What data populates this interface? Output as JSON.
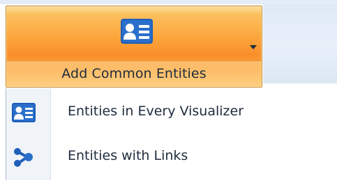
{
  "ribbon": {
    "add_common_entities": {
      "label": "Add Common Entities",
      "icon": "contact-card-icon",
      "dropdown_icon": "dropdown-arrow-icon"
    }
  },
  "menu": {
    "items": [
      {
        "label": "Entities in Every Visualizer",
        "icon": "contact-card-icon"
      },
      {
        "label": "Entities with Links",
        "icon": "linked-nodes-icon"
      }
    ]
  },
  "colors": {
    "button_highlight": "#fba43a",
    "icon_blue": "#1f5fb8"
  }
}
